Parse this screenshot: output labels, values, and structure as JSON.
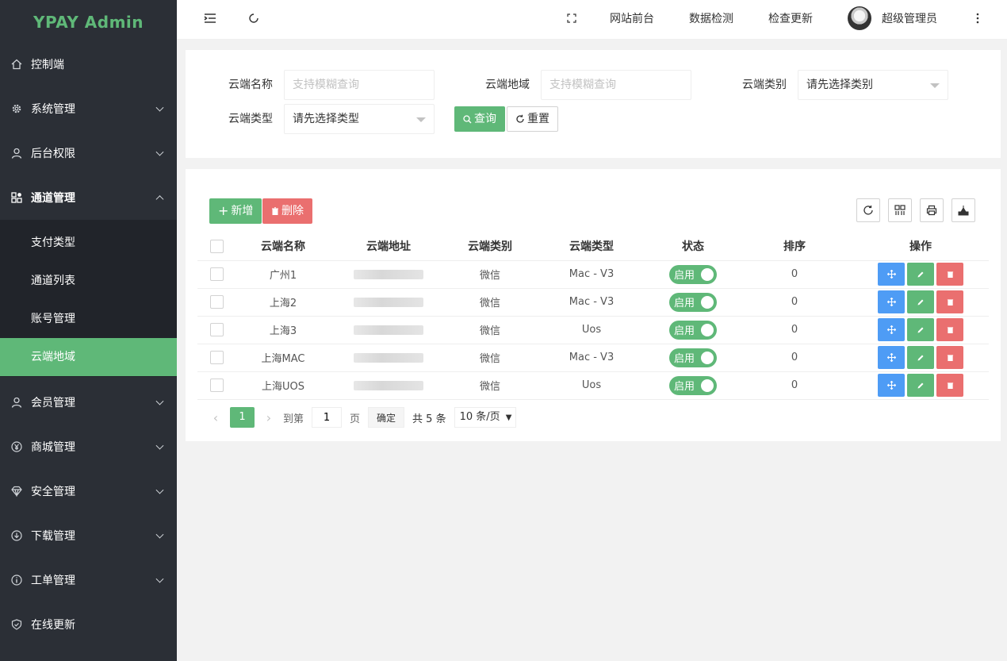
{
  "app": {
    "title": "YPAY Admin"
  },
  "colors": {
    "primary": "#5fb878",
    "sidebar": "#2b2f36",
    "danger": "#ea6f6f",
    "info": "#4e9cf5"
  },
  "sidebar": {
    "items": [
      {
        "label": "控制端",
        "icon": "home-icon"
      },
      {
        "label": "系统管理",
        "icon": "gear-icon"
      },
      {
        "label": "后台权限",
        "icon": "user-icon"
      },
      {
        "label": "通道管理",
        "icon": "apps-icon"
      },
      {
        "label": "会员管理",
        "icon": "user-icon"
      },
      {
        "label": "商城管理",
        "icon": "yen-icon"
      },
      {
        "label": "安全管理",
        "icon": "diamond-icon"
      },
      {
        "label": "下载管理",
        "icon": "download-icon"
      },
      {
        "label": "工单管理",
        "icon": "info-icon"
      },
      {
        "label": "在线更新",
        "icon": "shield-icon"
      }
    ],
    "submenu": [
      {
        "label": "支付类型"
      },
      {
        "label": "通道列表"
      },
      {
        "label": "账号管理"
      },
      {
        "label": "云端地域"
      }
    ]
  },
  "header": {
    "links": [
      "网站前台",
      "数据检测",
      "检查更新"
    ],
    "user": "超级管理员"
  },
  "search": {
    "name_label": "云端名称",
    "name_placeholder": "支持模糊查询",
    "addr_label": "云端地域",
    "addr_placeholder": "支持模糊查询",
    "category_label": "云端类别",
    "category_value": "请先选择类别",
    "type_label": "云端类型",
    "type_value": "请先选择类型",
    "query_label": "查询",
    "reset_label": "重置"
  },
  "toolbar": {
    "add_label": "新增",
    "delete_label": "删除"
  },
  "table": {
    "headers": [
      "云端名称",
      "云端地址",
      "云端类别",
      "云端类型",
      "状态",
      "排序",
      "操作"
    ],
    "rows": [
      {
        "name": "广州1",
        "category": "微信",
        "type": "Mac - V3",
        "status": "启用",
        "sort": "0"
      },
      {
        "name": "上海2",
        "category": "微信",
        "type": "Mac - V3",
        "status": "启用",
        "sort": "0"
      },
      {
        "name": "上海3",
        "category": "微信",
        "type": "Uos",
        "status": "启用",
        "sort": "0"
      },
      {
        "name": "上海MAC",
        "category": "微信",
        "type": "Mac - V3",
        "status": "启用",
        "sort": "0"
      },
      {
        "name": "上海UOS",
        "category": "微信",
        "type": "Uos",
        "status": "启用",
        "sort": "0"
      }
    ]
  },
  "pagination": {
    "current": "1",
    "goto_label": "到第",
    "goto_value": "1",
    "page_label": "页",
    "confirm_label": "确定",
    "total_label": "共 5 条",
    "page_size": "10 条/页"
  }
}
